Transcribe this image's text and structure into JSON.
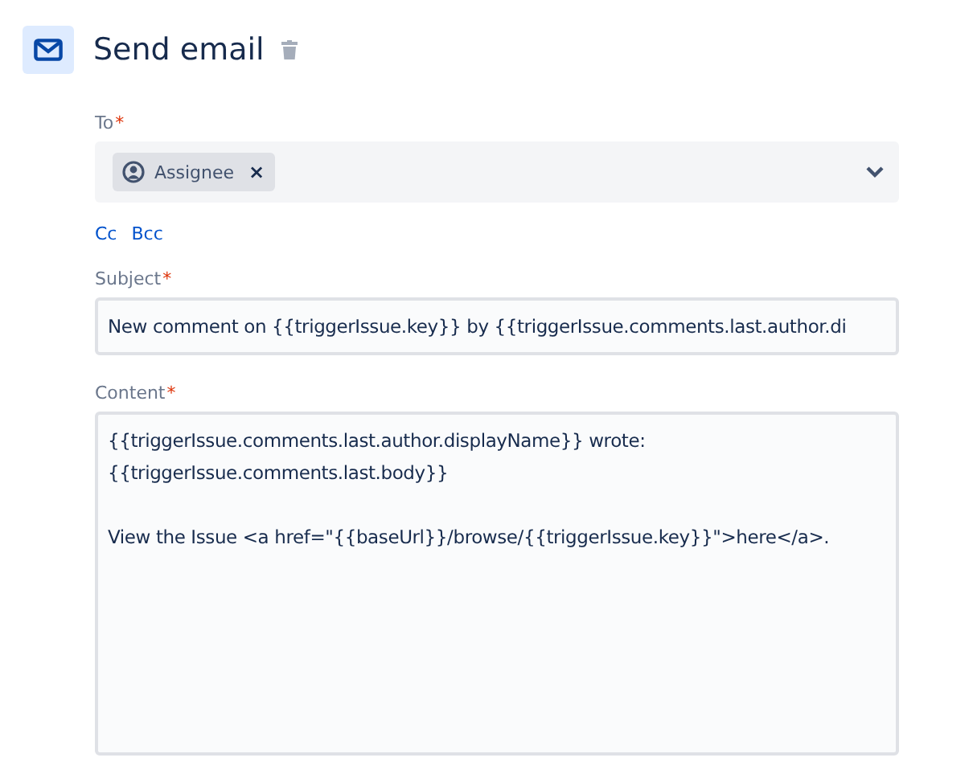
{
  "header": {
    "title": "Send email"
  },
  "to": {
    "label": "To",
    "required_mark": "*",
    "tags": [
      {
        "label": "Assignee",
        "remove": "×"
      }
    ]
  },
  "copy_links": [
    "Cc",
    "Bcc"
  ],
  "subject": {
    "label": "Subject",
    "required_mark": "*",
    "value": "New comment on {{triggerIssue.key}} by {{triggerIssue.comments.last.author.di"
  },
  "content": {
    "label": "Content",
    "required_mark": "*",
    "value": "{{triggerIssue.comments.last.author.displayName}} wrote:\n{{triggerIssue.comments.last.body}}\n\nView the Issue <a href=\"{{baseUrl}}/browse/{{triggerIssue.key}}\">here</a>."
  }
}
